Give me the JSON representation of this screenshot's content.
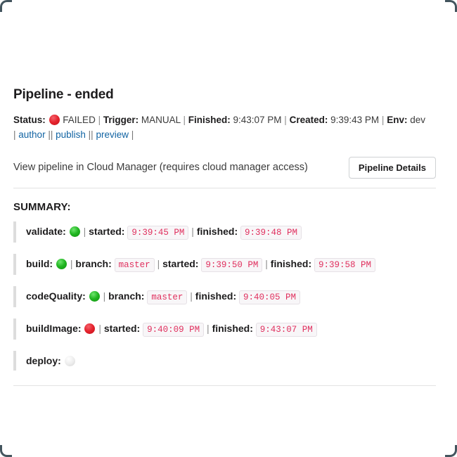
{
  "window": {
    "corner_color": "#43555e"
  },
  "header": {
    "title": "Pipeline - ended"
  },
  "meta": {
    "status_label": "Status:",
    "status_icon": "red-circle-icon",
    "status_value": "FAILED",
    "trigger_label": "Trigger:",
    "trigger_value": "MANUAL",
    "finished_label": "Finished:",
    "finished_value": "9:43:07 PM",
    "created_label": "Created:",
    "created_value": "9:39:43 PM",
    "env_label": "Env:",
    "env_value": "dev",
    "separator": "|"
  },
  "links": {
    "open_bar": "|",
    "double_bar": "||",
    "close_bar": "|",
    "author": "author",
    "publish": "publish",
    "preview": "preview",
    "color": "#1264a3"
  },
  "view_row": {
    "text": "View pipeline in Cloud Manager (requires cloud manager access)",
    "button_label": "Pipeline Details"
  },
  "summary": {
    "heading": "SUMMARY:",
    "steps": [
      {
        "name": "validate:",
        "status_icon": "green-circle-icon",
        "status": "green",
        "fields": [
          {
            "sep": "|",
            "label": "started:",
            "value": "9:39:45 PM"
          },
          {
            "sep": "|",
            "label": "finished:",
            "value": "9:39:48 PM"
          }
        ]
      },
      {
        "name": "build:",
        "status_icon": "green-circle-icon",
        "status": "green",
        "fields": [
          {
            "sep": "|",
            "label": "branch:",
            "value": "master"
          },
          {
            "sep": "|",
            "label": "started:",
            "value": "9:39:50 PM"
          },
          {
            "sep": "|",
            "label": "finished:",
            "value": "9:39:58 PM"
          }
        ]
      },
      {
        "name": "codeQuality:",
        "status_icon": "green-circle-icon",
        "status": "green",
        "fields": [
          {
            "sep": "|",
            "label": "branch:",
            "value": "master"
          },
          {
            "sep": "|",
            "label": "finished:",
            "value": "9:40:05 PM"
          }
        ]
      },
      {
        "name": "buildImage:",
        "status_icon": "red-circle-icon",
        "status": "red",
        "fields": [
          {
            "sep": "|",
            "label": "started:",
            "value": "9:40:09 PM"
          },
          {
            "sep": "|",
            "label": "finished:",
            "value": "9:43:07 PM"
          }
        ]
      },
      {
        "name": "deploy:",
        "status_icon": "white-circle-icon",
        "status": "white",
        "fields": []
      }
    ]
  },
  "colors": {
    "status_failed": "#e5232d",
    "status_success": "#21b521",
    "status_pending": "#ececec",
    "code_text": "#e0305e",
    "code_bg": "#f8f6f8",
    "rule": "#e2e2e2"
  }
}
